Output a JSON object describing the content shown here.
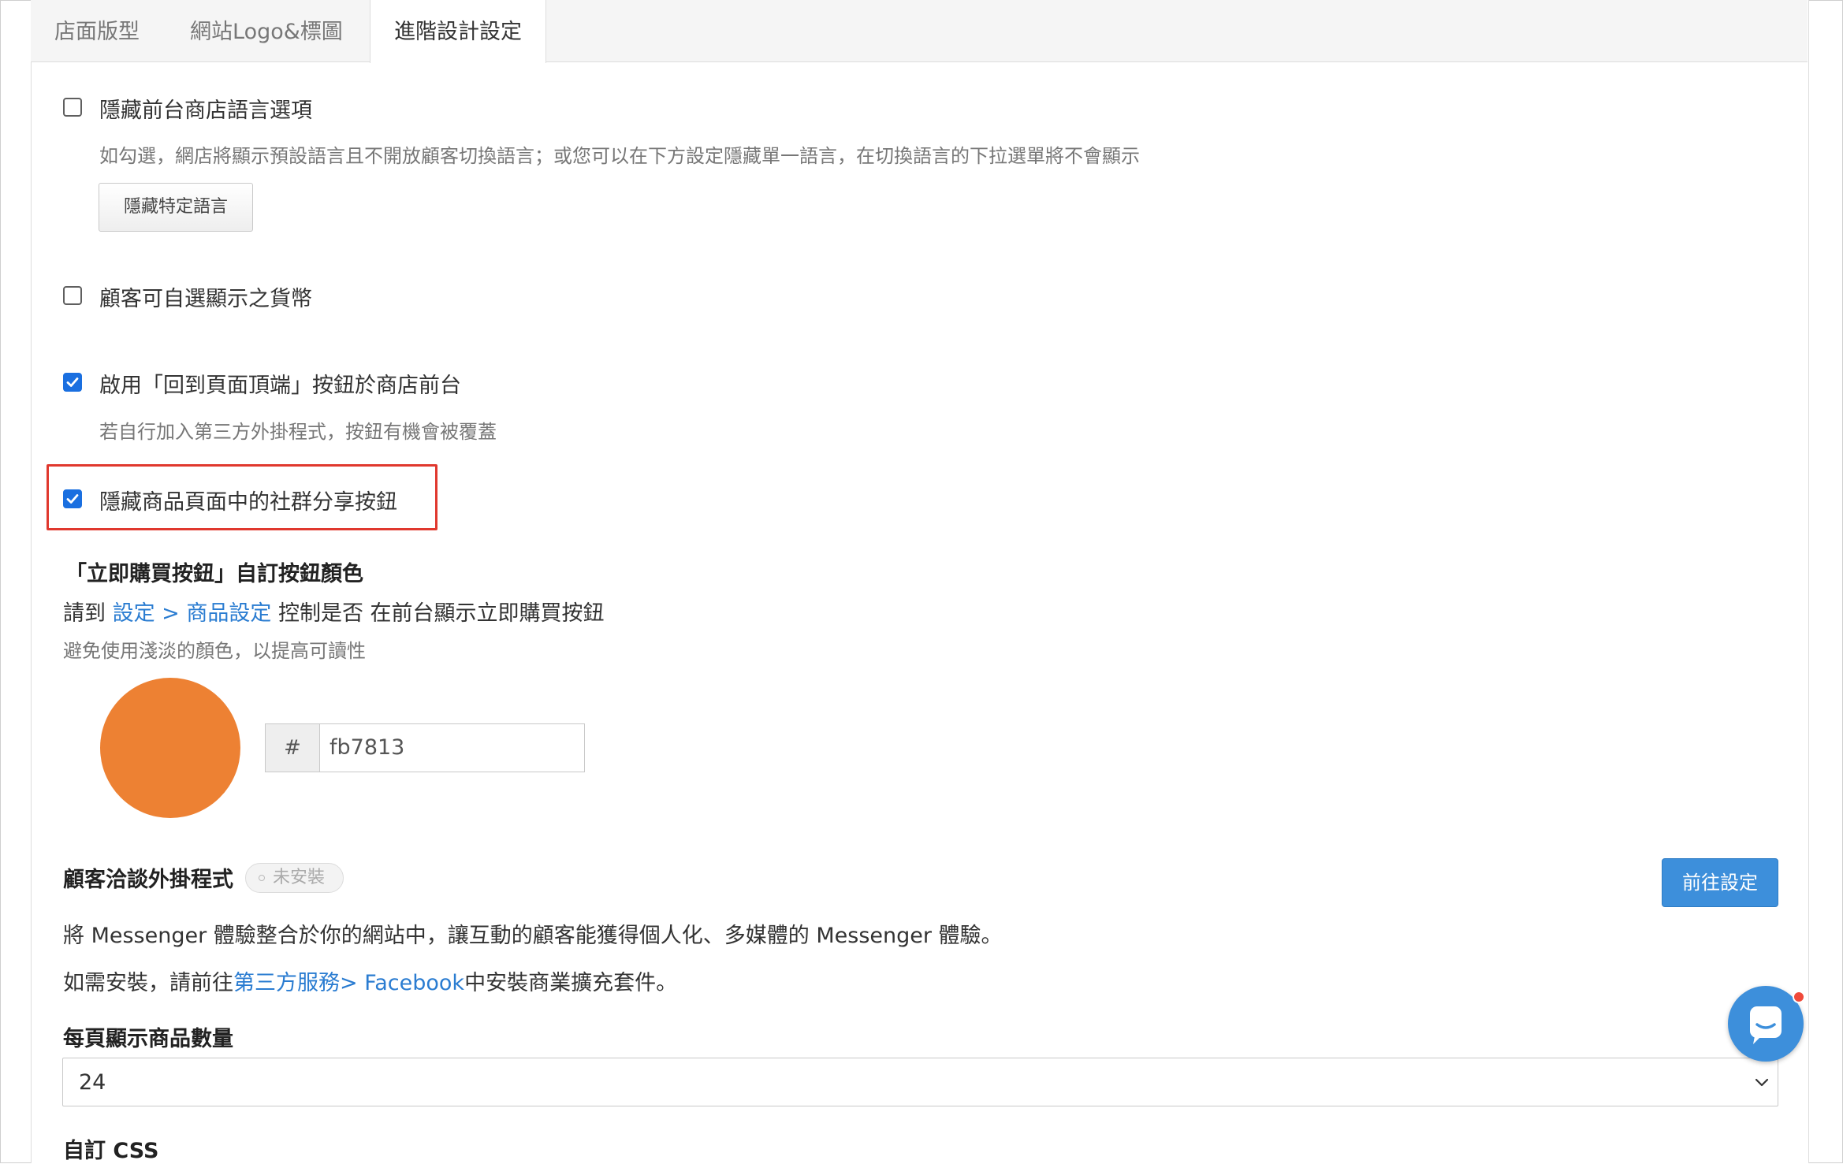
{
  "tabs": [
    {
      "label": "店面版型",
      "active": false
    },
    {
      "label": "網站Logo&標圖",
      "active": false
    },
    {
      "label": "進階設計設定",
      "active": true
    }
  ],
  "settings": {
    "hide_language": {
      "checked": false,
      "label": "隱藏前台商店語言選項",
      "hint": "如勾選，網店將顯示預設語言且不開放顧客切換語言；或您可以在下方設定隱藏單一語言，在切換語言的下拉選單將不會顯示",
      "button_label": "隱藏特定語言"
    },
    "currency": {
      "checked": false,
      "label": "顧客可自選顯示之貨幣"
    },
    "back_to_top": {
      "checked": true,
      "label": "啟用「回到頁面頂端」按鈕於商店前台",
      "hint": "若自行加入第三方外掛程式，按鈕有機會被覆蓋"
    },
    "hide_social": {
      "checked": true,
      "label": "隱藏商品頁面中的社群分享按鈕"
    }
  },
  "buy_now_color": {
    "title": "「立即購買按鈕」自訂按鈕顏色",
    "desc_prefix": "請到 ",
    "desc_link": "設定 > 商品設定",
    "desc_suffix": " 控制是否 在前台顯示立即購買按鈕",
    "hint": "避免使用淺淡的顏色，以提高可讀性",
    "hash": "#",
    "value": "fb7813",
    "swatch_color": "#ed8133"
  },
  "messenger": {
    "title": "顧客洽談外掛程式",
    "badge": "未安裝",
    "button_label": "前往設定",
    "desc1": "將 Messenger 體驗整合於你的網站中，讓互動的顧客能獲得個人化、多媒體的 Messenger 體驗。",
    "desc2_prefix": "如需安裝，請前往",
    "desc2_link": "第三方服務> Facebook",
    "desc2_suffix": "中安裝商業擴充套件。"
  },
  "per_page": {
    "title": "每頁顯示商品數量",
    "value": "24"
  },
  "custom_css": {
    "title": "自訂 CSS"
  },
  "colors": {
    "accent": "#1a6fe0",
    "link": "#2a7cd1",
    "primary_button": "#3d8fdb",
    "highlight_border": "#e0382e"
  }
}
